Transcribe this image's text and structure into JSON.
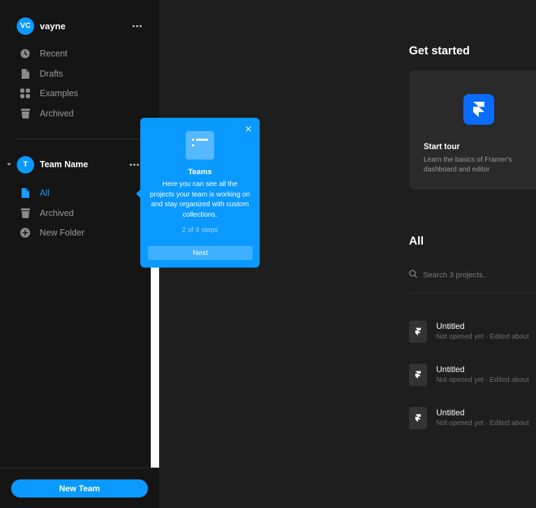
{
  "sidebar": {
    "user": {
      "initials": "VC",
      "name": "vayne"
    },
    "items": [
      {
        "label": "Recent",
        "icon": "clock-icon"
      },
      {
        "label": "Drafts",
        "icon": "file-icon"
      },
      {
        "label": "Examples",
        "icon": "grid-icon"
      },
      {
        "label": "Archived",
        "icon": "archive-icon"
      }
    ],
    "team": {
      "initials": "T",
      "name": "Team Name",
      "items": [
        {
          "label": "All",
          "icon": "file-icon",
          "active": true
        },
        {
          "label": "Archived",
          "icon": "archive-icon"
        },
        {
          "label": "New Folder",
          "icon": "plus-circle-icon"
        }
      ]
    },
    "new_team_label": "New Team"
  },
  "main": {
    "get_started_title": "Get started",
    "tour": {
      "title": "Start tour",
      "description": "Learn the basics of Framer's dashboard and editor"
    },
    "all_title": "All",
    "search_placeholder": "Search 3 projects...",
    "projects": [
      {
        "title": "Untitled",
        "meta": "Not opened yet · Edited about"
      },
      {
        "title": "Untitled",
        "meta": "Not opened yet · Edited about"
      },
      {
        "title": "Untitled",
        "meta": "Not opened yet · Edited about"
      }
    ]
  },
  "popover": {
    "title": "Teams",
    "text": "Here you can see all the projects your team is working on and stay organized with custom collections.",
    "steps": "2 of 4 steps",
    "next_label": "Next"
  },
  "colors": {
    "accent": "#0a99ff",
    "sidebar_bg": "#151515",
    "main_bg": "#1e1e1e",
    "card_bg": "#2a2a2a",
    "framer_blue": "#0a6cff"
  }
}
